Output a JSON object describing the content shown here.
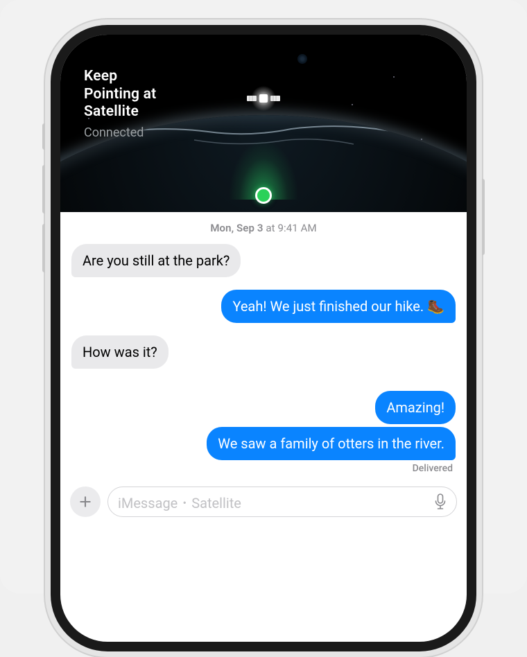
{
  "satellite": {
    "title_line1": "Keep",
    "title_line2": "Pointing at",
    "title_line3": "Satellite",
    "status": "Connected"
  },
  "conversation": {
    "timestamp_day": "Mon, Sep 3",
    "timestamp_at": " at ",
    "timestamp_time": "9:41 AM",
    "messages": {
      "m0": "Are you still at the park?",
      "m1": "Yeah! We just finished our hike. 🥾",
      "m2": "How was it?",
      "m3": "Amazing!",
      "m4": "We saw a family of otters in the river."
    },
    "delivered_label": "Delivered"
  },
  "input": {
    "placeholder": "iMessage ･ Satellite"
  }
}
